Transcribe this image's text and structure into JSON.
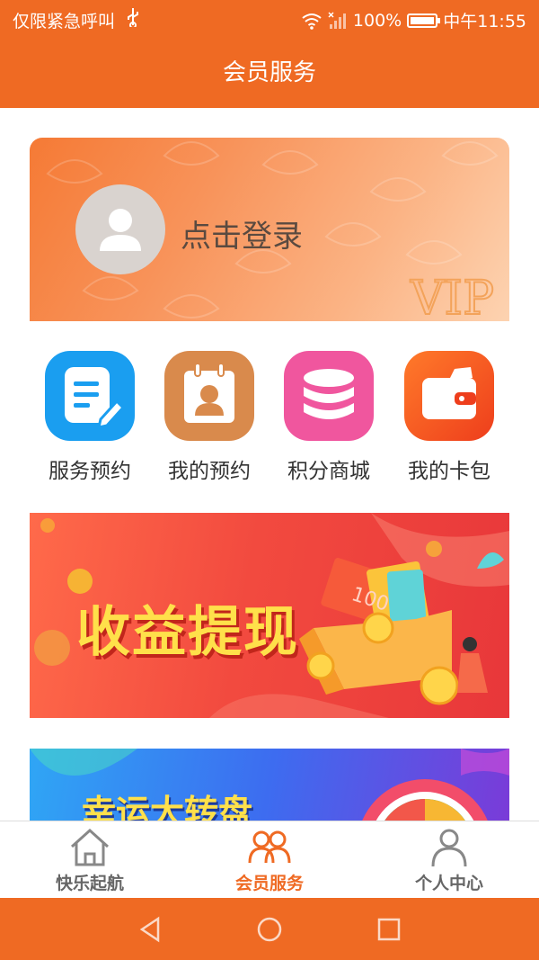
{
  "status_bar": {
    "left_text": "仅限紧急呼叫",
    "battery": "100%",
    "time": "中午11:55"
  },
  "header": {
    "title": "会员服务"
  },
  "vip_card": {
    "login_text": "点击登录",
    "badge": "VIP"
  },
  "menu": {
    "items": [
      {
        "label": "服务预约",
        "icon": "document-edit-icon",
        "color": "#1a9ef0"
      },
      {
        "label": "我的预约",
        "icon": "calendar-contact-icon",
        "color": "#d98a4c"
      },
      {
        "label": "积分商城",
        "icon": "coin-stack-icon",
        "color": "#f0569e"
      },
      {
        "label": "我的卡包",
        "icon": "wallet-icon",
        "color": "#f25a1f"
      }
    ]
  },
  "banners": {
    "withdraw": "收益提现",
    "withdraw_ticket": "100",
    "wheel": "幸运大转盘"
  },
  "tabbar": {
    "items": [
      {
        "label": "快乐起航",
        "icon": "home-icon",
        "active": false
      },
      {
        "label": "会员服务",
        "icon": "members-icon",
        "active": true
      },
      {
        "label": "个人中心",
        "icon": "person-icon",
        "active": false
      }
    ]
  },
  "colors": {
    "brand": "#ef6a23",
    "text_dark": "#333333",
    "tab_inactive": "#666666"
  }
}
